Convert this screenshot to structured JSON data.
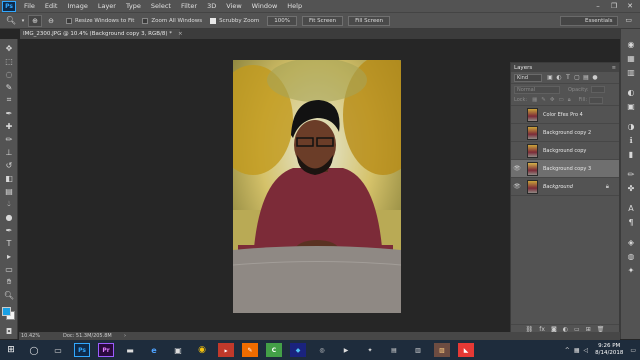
{
  "menu": {
    "logo": "Ps",
    "items": [
      "File",
      "Edit",
      "Image",
      "Layer",
      "Type",
      "Select",
      "Filter",
      "3D",
      "View",
      "Window",
      "Help"
    ]
  },
  "options": {
    "resize_windows_label": "Resize Windows to Fit",
    "zoom_all_label": "Zoom All Windows",
    "scrubby_label": "Scrubby Zoom",
    "zoom_100": "100%",
    "fit_screen": "Fit Screen",
    "fill_screen": "Fill Screen",
    "workspace": "Essentials"
  },
  "document": {
    "tab_title": "IMG_2300.JPG @ 10.4% (Background copy 3, RGB/8) *",
    "tab_close": "×"
  },
  "layers_panel": {
    "title": "Layers",
    "kind": "Kind",
    "blend_mode": "Normal",
    "opacity_label": "Opacity:",
    "lock_label": "Lock:",
    "fill_label": "Fill:",
    "layers": [
      {
        "name": "Color Efex Pro 4",
        "visible": false,
        "selected": false
      },
      {
        "name": "Background copy 2",
        "visible": false,
        "selected": false
      },
      {
        "name": "Background copy",
        "visible": false,
        "selected": false
      },
      {
        "name": "Background copy 3",
        "visible": true,
        "selected": true
      },
      {
        "name": "Background",
        "visible": true,
        "selected": false,
        "locked": true
      }
    ]
  },
  "status": {
    "zoom": "10.42%",
    "doc": "Doc: 51.3M/205.8M"
  },
  "taskbar": {
    "time": "9:26 PM",
    "date": "8/14/2018",
    "apps": [
      "Ps",
      "Pr"
    ]
  },
  "colors": {
    "foreground": "#1aa0e4",
    "background": "#f4f4f4",
    "panel": "#535353",
    "canvas_bg": "#262626"
  }
}
